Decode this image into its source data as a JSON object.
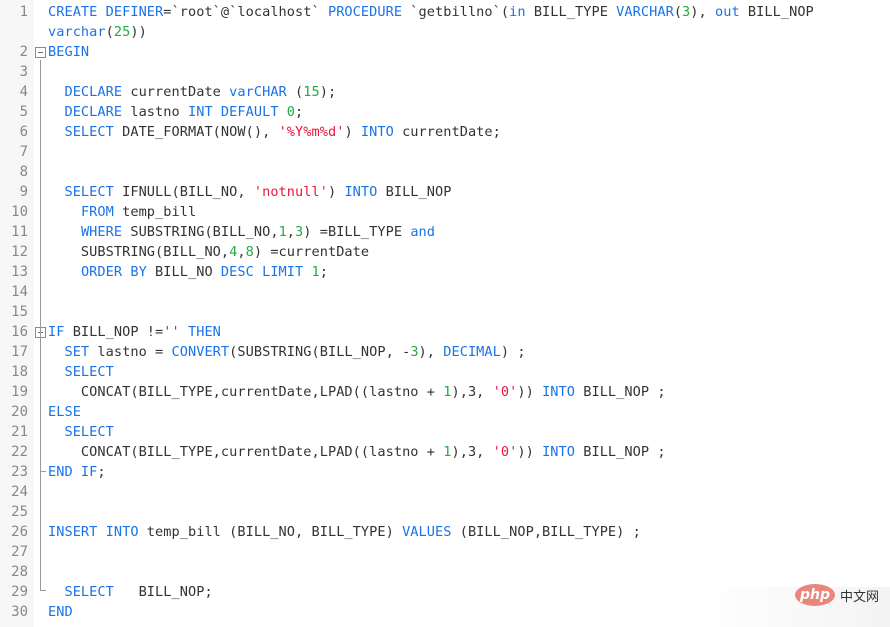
{
  "editor": {
    "language": "sql",
    "colors": {
      "keyword": "#1a73e8",
      "number": "#22aa44",
      "string": "#e8173c",
      "text": "#333333",
      "line_number": "#888888",
      "gutter_bg": "#f7f7f7"
    },
    "lines": [
      {
        "n": "1",
        "tokens": [
          [
            "kw",
            "CREATE DEFINER"
          ],
          [
            "t",
            "=`root`@`localhost` "
          ],
          [
            "kw",
            "PROCEDURE"
          ],
          [
            "t",
            " `getbillno`("
          ],
          [
            "kw",
            "in"
          ],
          [
            "t",
            " BILL_TYPE "
          ],
          [
            "kw",
            "VARCHAR"
          ],
          [
            "t",
            "("
          ],
          [
            "num",
            "3"
          ],
          [
            "t",
            "), "
          ],
          [
            "kw",
            "out"
          ],
          [
            "t",
            " BILL_NOP"
          ]
        ]
      },
      {
        "n": "",
        "tokens": [
          [
            "kw",
            "varchar"
          ],
          [
            "t",
            "("
          ],
          [
            "num",
            "25"
          ],
          [
            "t",
            "))"
          ]
        ]
      },
      {
        "n": "2",
        "fold": "open",
        "tokens": [
          [
            "kw",
            "BEGIN"
          ]
        ]
      },
      {
        "n": "3",
        "tokens": []
      },
      {
        "n": "4",
        "tokens": [
          [
            "t",
            "  "
          ],
          [
            "kw",
            "DECLARE"
          ],
          [
            "t",
            " currentDate "
          ],
          [
            "kw",
            "varCHAR"
          ],
          [
            "t",
            " ("
          ],
          [
            "num",
            "15"
          ],
          [
            "t",
            ");"
          ]
        ]
      },
      {
        "n": "5",
        "tokens": [
          [
            "t",
            "  "
          ],
          [
            "kw",
            "DECLARE"
          ],
          [
            "t",
            " lastno "
          ],
          [
            "kw",
            "INT DEFAULT"
          ],
          [
            "t",
            " "
          ],
          [
            "num",
            "0"
          ],
          [
            "t",
            ";"
          ]
        ]
      },
      {
        "n": "6",
        "tokens": [
          [
            "t",
            "  "
          ],
          [
            "kw",
            "SELECT"
          ],
          [
            "t",
            " DATE_FORMAT(NOW(), "
          ],
          [
            "str",
            "'%Y%m%d'"
          ],
          [
            "t",
            ") "
          ],
          [
            "kw",
            "INTO"
          ],
          [
            "t",
            " currentDate;"
          ]
        ]
      },
      {
        "n": "7",
        "tokens": []
      },
      {
        "n": "8",
        "tokens": []
      },
      {
        "n": "9",
        "tokens": [
          [
            "t",
            "  "
          ],
          [
            "kw",
            "SELECT"
          ],
          [
            "t",
            " IFNULL(BILL_NO, "
          ],
          [
            "str",
            "'notnull'"
          ],
          [
            "t",
            ") "
          ],
          [
            "kw",
            "INTO"
          ],
          [
            "t",
            " BILL_NOP"
          ]
        ]
      },
      {
        "n": "10",
        "tokens": [
          [
            "t",
            "    "
          ],
          [
            "kw",
            "FROM"
          ],
          [
            "t",
            " temp_bill"
          ]
        ]
      },
      {
        "n": "11",
        "tokens": [
          [
            "t",
            "    "
          ],
          [
            "kw",
            "WHERE"
          ],
          [
            "t",
            " SUBSTRING(BILL_NO,"
          ],
          [
            "num",
            "1"
          ],
          [
            "t",
            ","
          ],
          [
            "num",
            "3"
          ],
          [
            "t",
            ") =BILL_TYPE "
          ],
          [
            "kw",
            "and"
          ]
        ]
      },
      {
        "n": "12",
        "tokens": [
          [
            "t",
            "    SUBSTRING(BILL_NO,"
          ],
          [
            "num",
            "4"
          ],
          [
            "t",
            ","
          ],
          [
            "num",
            "8"
          ],
          [
            "t",
            ") =currentDate"
          ]
        ]
      },
      {
        "n": "13",
        "tokens": [
          [
            "t",
            "    "
          ],
          [
            "kw",
            "ORDER BY"
          ],
          [
            "t",
            " BILL_NO "
          ],
          [
            "kw",
            "DESC LIMIT"
          ],
          [
            "t",
            " "
          ],
          [
            "num",
            "1"
          ],
          [
            "t",
            ";"
          ]
        ]
      },
      {
        "n": "14",
        "tokens": []
      },
      {
        "n": "15",
        "tokens": []
      },
      {
        "n": "16",
        "fold": "open",
        "tokens": [
          [
            "kw",
            "IF"
          ],
          [
            "t",
            " BILL_NOP !="
          ],
          [
            "str",
            "''"
          ],
          [
            "t",
            " "
          ],
          [
            "kw",
            "THEN"
          ]
        ]
      },
      {
        "n": "17",
        "tokens": [
          [
            "t",
            "  "
          ],
          [
            "kw",
            "SET"
          ],
          [
            "t",
            " lastno = "
          ],
          [
            "kw",
            "CONVERT"
          ],
          [
            "t",
            "(SUBSTRING(BILL_NOP, -"
          ],
          [
            "num",
            "3"
          ],
          [
            "t",
            "), "
          ],
          [
            "kw",
            "DECIMAL"
          ],
          [
            "t",
            ") ;"
          ]
        ]
      },
      {
        "n": "18",
        "tokens": [
          [
            "t",
            "  "
          ],
          [
            "kw",
            "SELECT"
          ]
        ]
      },
      {
        "n": "19",
        "tokens": [
          [
            "t",
            "    CONCAT(BILL_TYPE,currentDate,LPAD((lastno + "
          ],
          [
            "num",
            "1"
          ],
          [
            "t",
            "),3, "
          ],
          [
            "str",
            "'0'"
          ],
          [
            "t",
            ")) "
          ],
          [
            "kw",
            "INTO"
          ],
          [
            "t",
            " BILL_NOP ;"
          ]
        ]
      },
      {
        "n": "20",
        "tokens": [
          [
            "kw",
            "ELSE"
          ]
        ]
      },
      {
        "n": "21",
        "tokens": [
          [
            "t",
            "  "
          ],
          [
            "kw",
            "SELECT"
          ]
        ]
      },
      {
        "n": "22",
        "tokens": [
          [
            "t",
            "    CONCAT(BILL_TYPE,currentDate,LPAD((lastno + "
          ],
          [
            "num",
            "1"
          ],
          [
            "t",
            "),3, "
          ],
          [
            "str",
            "'0'"
          ],
          [
            "t",
            ")) "
          ],
          [
            "kw",
            "INTO"
          ],
          [
            "t",
            " BILL_NOP ;"
          ]
        ]
      },
      {
        "n": "23",
        "fold": "end",
        "tokens": [
          [
            "kw",
            "END IF"
          ],
          [
            "t",
            ";"
          ]
        ]
      },
      {
        "n": "24",
        "tokens": []
      },
      {
        "n": "25",
        "tokens": []
      },
      {
        "n": "26",
        "tokens": [
          [
            "kw",
            "INSERT INTO"
          ],
          [
            "t",
            " temp_bill (BILL_NO, BILL_TYPE) "
          ],
          [
            "kw",
            "VALUES"
          ],
          [
            "t",
            " (BILL_NOP,BILL_TYPE) ;"
          ]
        ]
      },
      {
        "n": "27",
        "tokens": []
      },
      {
        "n": "28",
        "tokens": []
      },
      {
        "n": "29",
        "fold": "corner",
        "tokens": [
          [
            "t",
            "  "
          ],
          [
            "kw",
            "SELECT"
          ],
          [
            "t",
            "   BILL_NOP;"
          ]
        ]
      },
      {
        "n": "30",
        "tokens": [
          [
            "kw",
            "END"
          ]
        ]
      }
    ]
  },
  "watermark": {
    "logo_text": "php",
    "site_text": "中文网"
  }
}
